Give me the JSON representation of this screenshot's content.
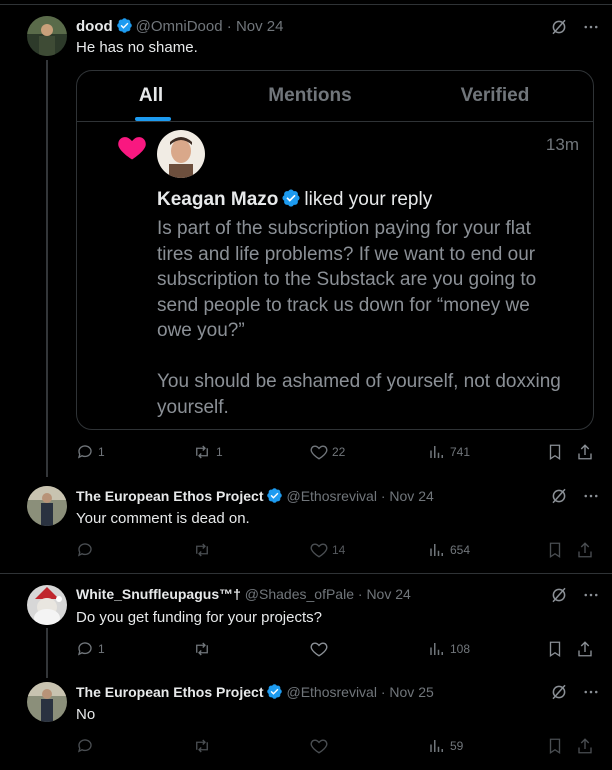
{
  "tweets": [
    {
      "name": "dood",
      "handle": "@OmniDood",
      "date": "Nov 24",
      "text": "He has no shame.",
      "replies": "1",
      "retweets": "1",
      "likes": "22",
      "views": "741"
    },
    {
      "name": "The European Ethos Project",
      "handle": "@Ethosrevival",
      "date": "Nov 24",
      "text": "Your comment is dead on.",
      "replies": "",
      "retweets": "",
      "likes": "14",
      "views": "654"
    },
    {
      "name": "White_Snuffleupagus™†",
      "handle": "@Shades_ofPale",
      "date": "Nov 24",
      "text": "Do you get funding for your projects?",
      "replies": "1",
      "retweets": "",
      "likes": "",
      "views": "108"
    },
    {
      "name": "The European Ethos Project",
      "handle": "@Ethosrevival",
      "date": "Nov 25",
      "text": "No",
      "replies": "",
      "retweets": "",
      "likes": "",
      "views": "59"
    }
  ],
  "separator": " · ",
  "embed": {
    "tabs": [
      "All",
      "Mentions",
      "Verified"
    ],
    "time": "13m",
    "user": "Keagan Mazo",
    "action": "liked your reply",
    "body_lines": [
      "Is part of the subscription paying for your flat",
      "tires and life problems? If we want to end our",
      "subscription to the Substack are you going to",
      "send people to track us down for “money we",
      "owe you?”",
      "",
      "You should be ashamed of yourself, not doxxing",
      "yourself."
    ]
  },
  "colors": {
    "background": "#000000",
    "accent": "#1d9bf0",
    "heart": "#f91880",
    "muted": "#71767b",
    "text": "#e7e9ea",
    "border": "#2f3336"
  },
  "icons": [
    "grok-icon",
    "more-icon",
    "verified-badge-icon",
    "reply-icon",
    "retweet-icon",
    "like-icon",
    "views-icon",
    "bookmark-icon",
    "share-icon",
    "heart-filled-icon"
  ]
}
